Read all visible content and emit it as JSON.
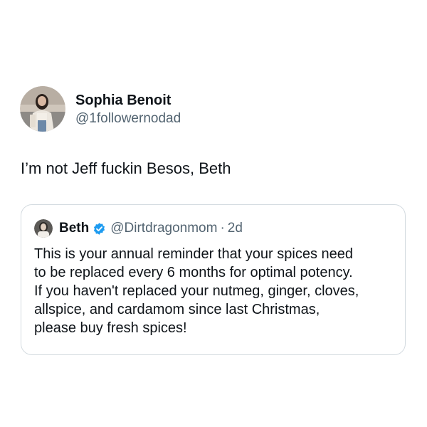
{
  "tweet": {
    "author": {
      "name": "Sophia Benoit",
      "handle": "@1followernodad",
      "avatar_icon": "profile-photo-avatar"
    },
    "text": "I’m not Jeff fuckin Besos, Beth",
    "quote": {
      "author": {
        "name": "Beth",
        "handle": "@Dirtdragonmom",
        "verified": true,
        "verified_color": "#1d9bf0",
        "avatar_icon": "profile-photo-avatar"
      },
      "separator": "·",
      "timestamp": "2d",
      "text_lines": [
        "This is your annual reminder that your spices need",
        "to be replaced every 6 months for optimal potency.",
        "If you haven't replaced your nutmeg, ginger, cloves,",
        "allspice, and cardamom since last Christmas,",
        "please buy fresh spices!"
      ]
    }
  },
  "colors": {
    "text_primary": "#0f1419",
    "text_secondary": "#536471",
    "card_border": "#d4dbe0",
    "accent": "#1d9bf0"
  }
}
